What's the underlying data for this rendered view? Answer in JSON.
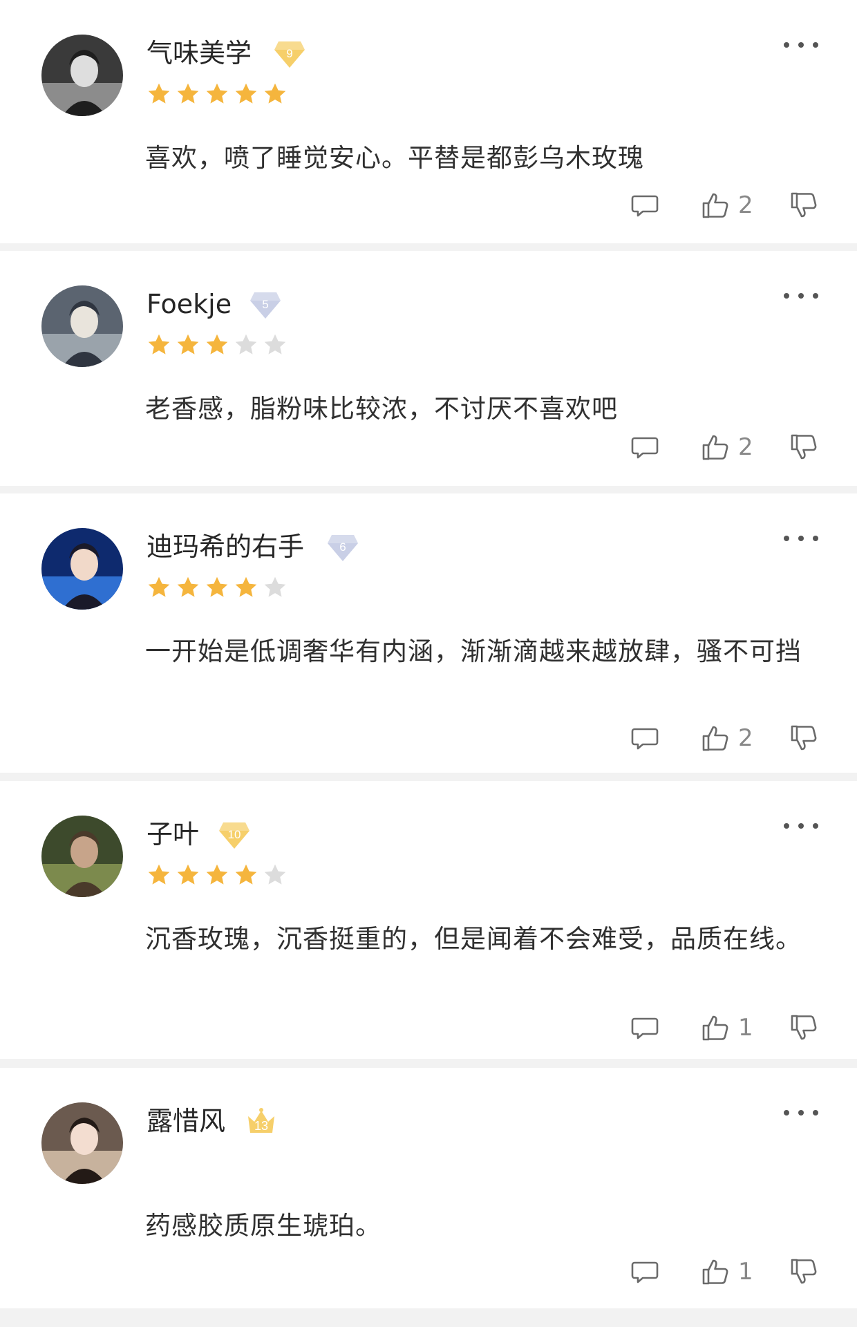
{
  "reviews": [
    {
      "username": "气味美学",
      "level": "9",
      "badge_type": "gold-diamond",
      "rating": 5,
      "text": "喜欢，喷了睡觉安心。平替是都彭乌木玫瑰",
      "likes": "2",
      "avatar_tone": "grayscale"
    },
    {
      "username": "Foekje",
      "level": "5",
      "badge_type": "silver-diamond",
      "rating": 3,
      "text": "老香感，脂粉味比较浓，不讨厌不喜欢吧",
      "likes": "2",
      "avatar_tone": "muted"
    },
    {
      "username": "迪玛希的右手",
      "level": "6",
      "badge_type": "silver-diamond",
      "rating": 4,
      "text": "一开始是低调奢华有内涵，渐渐滴越来越放肆，骚不可挡",
      "likes": "2",
      "avatar_tone": "blue"
    },
    {
      "username": "子叶",
      "level": "10",
      "badge_type": "gold-diamond",
      "rating": 4,
      "text": "沉香玫瑰，沉香挺重的，但是闻着不会难受，品质在线。",
      "likes": "1",
      "avatar_tone": "green"
    },
    {
      "username": "露惜风",
      "level": "13",
      "badge_type": "gold-crown",
      "rating": 0,
      "text": "药感胶质原生琥珀。",
      "likes": "1",
      "avatar_tone": "warm"
    }
  ],
  "colors": {
    "star_on": "#f5b53d",
    "star_off": "#dcdcdc",
    "badge_gold": "#f6cf6a",
    "badge_silver": "#c9cfe6",
    "icon_stroke": "#6a6a6a"
  },
  "icons": [
    "comment-icon",
    "thumbs-up-icon",
    "thumbs-down-icon",
    "more-icon",
    "star-icon",
    "level-badge-icon"
  ]
}
